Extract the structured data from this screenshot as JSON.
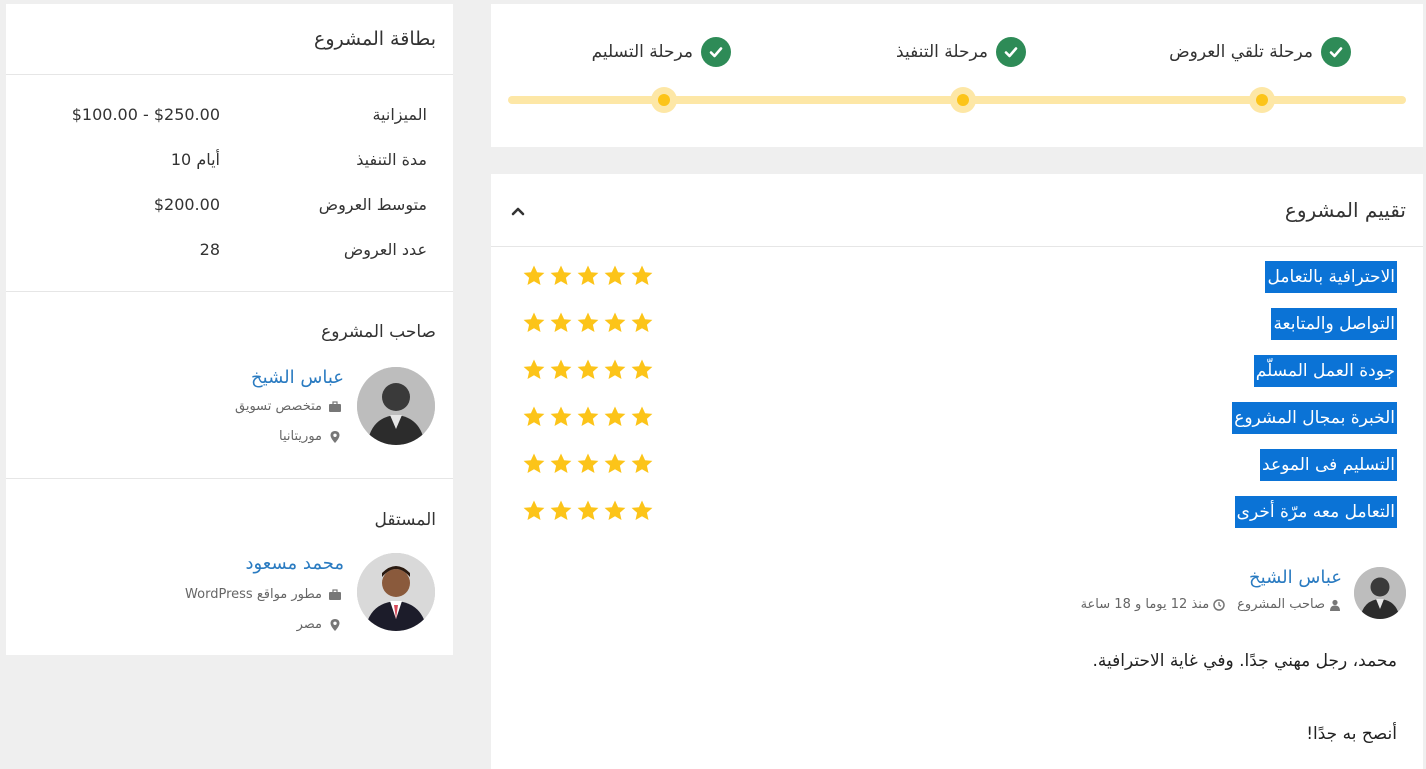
{
  "project_card": {
    "title": "بطاقة المشروع",
    "info": [
      {
        "label": "الميزانية",
        "value": "$100.00 - $250.00"
      },
      {
        "label": "مدة التنفيذ",
        "value": "10 أيام"
      },
      {
        "label": "متوسط العروض",
        "value": "$200.00"
      },
      {
        "label": "عدد العروض",
        "value": "28"
      }
    ],
    "owner_section": "صاحب المشروع",
    "owner": {
      "name": "عباس الشيخ",
      "role": "متخصص تسويق",
      "location": "موريتانيا"
    },
    "freelancer_section": "المستقل",
    "freelancer": {
      "name": "محمد مسعود",
      "role": "مطور مواقع WordPress",
      "location": "مصر"
    }
  },
  "stages": [
    {
      "label": "مرحلة تلقي العروض",
      "done": true
    },
    {
      "label": "مرحلة التنفيذ",
      "done": true
    },
    {
      "label": "مرحلة التسليم",
      "done": true
    }
  ],
  "rating": {
    "title": "تقييم المشروع",
    "criteria": [
      {
        "label": "الاحترافية بالتعامل",
        "stars": 5
      },
      {
        "label": "التواصل والمتابعة",
        "stars": 5
      },
      {
        "label": "جودة العمل المسلّم",
        "stars": 5
      },
      {
        "label": "الخبرة بمجال المشروع",
        "stars": 5
      },
      {
        "label": "التسليم فى الموعد",
        "stars": 5
      },
      {
        "label": "التعامل معه مرّة أخرى",
        "stars": 5
      }
    ],
    "review": {
      "author": "عباس الشيخ",
      "author_role": "صاحب المشروع",
      "time": "منذ 12 يوما و 18 ساعة",
      "paragraphs": [
        "محمد، رجل مهني جدًا. وفي غاية الاحترافية.",
        "أنصح به جدًا!"
      ]
    }
  },
  "colors": {
    "accent_blue": "#0b73d6",
    "link_blue": "#2a7bc1",
    "success_green": "#2e8b57",
    "star_gold": "#fcc419",
    "track_yellow": "#fde7a6"
  }
}
